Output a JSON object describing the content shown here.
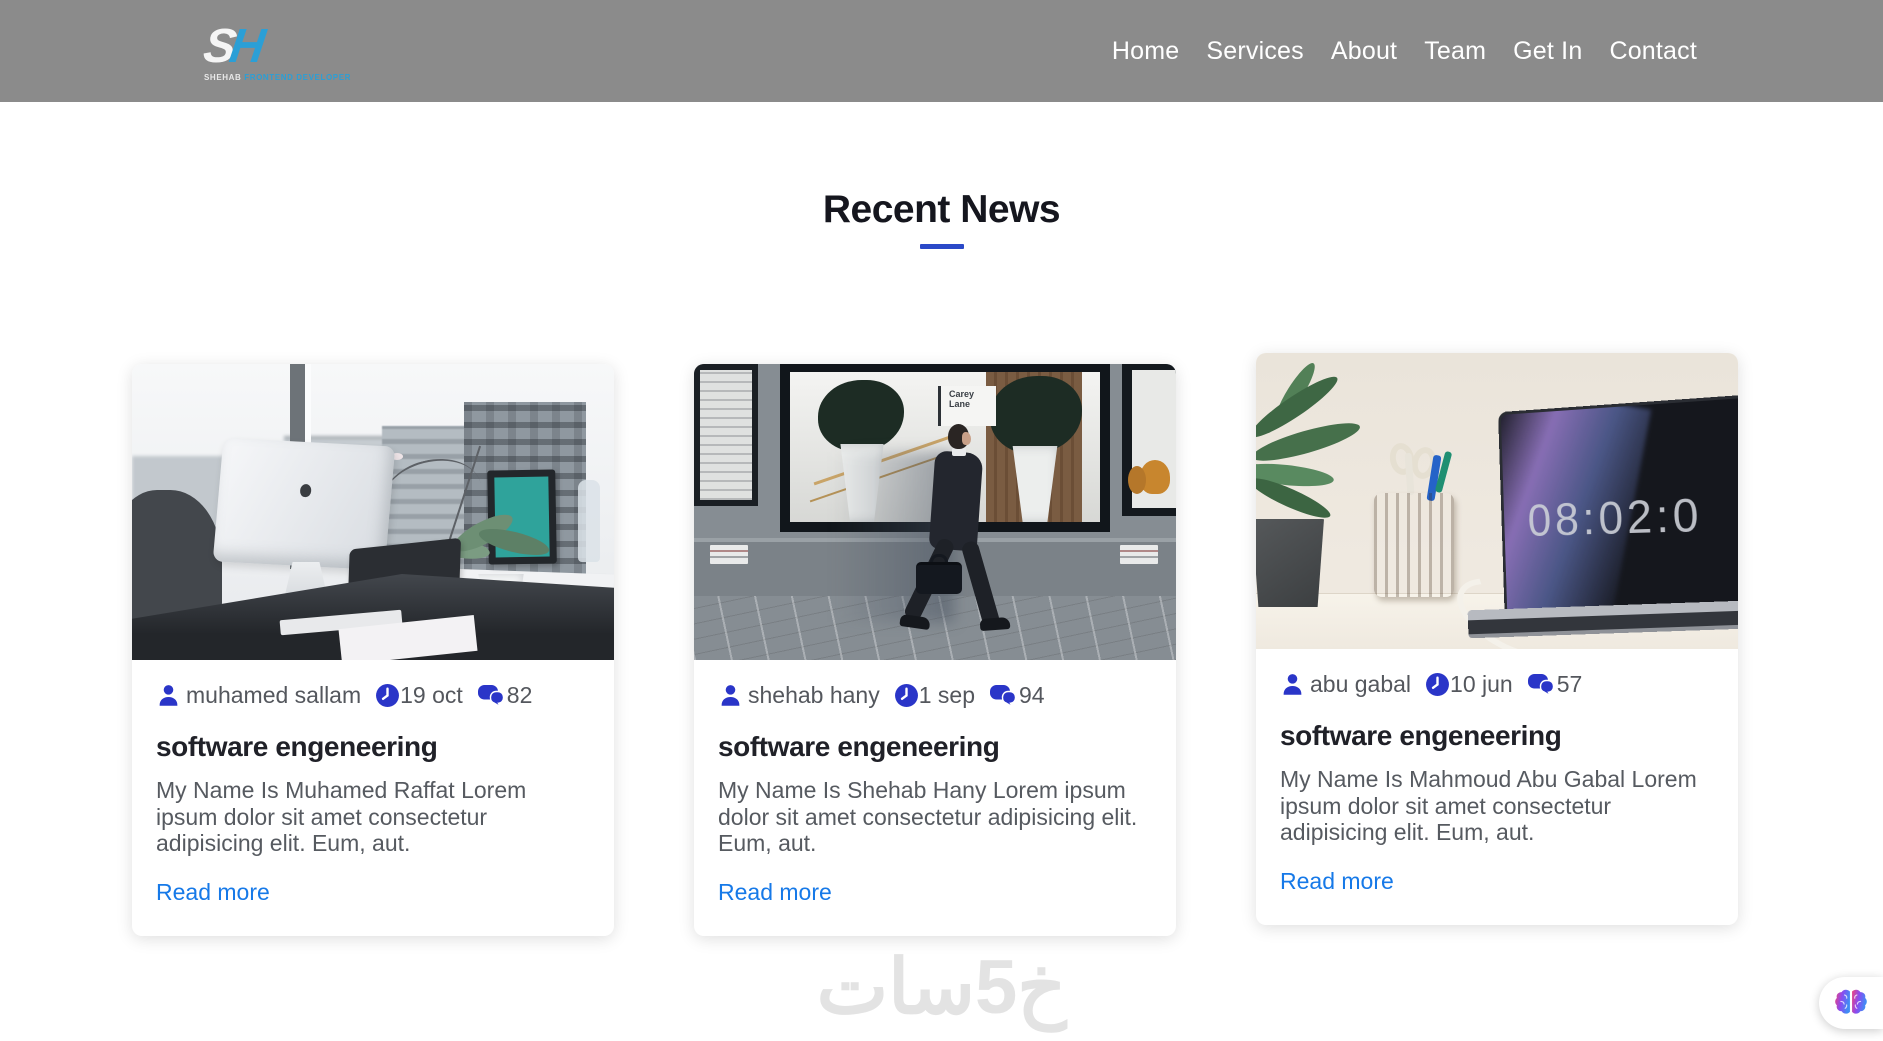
{
  "header": {
    "logo": {
      "letter_s": "S",
      "letter_h": "H",
      "tagline_primary": "SHEHAB",
      "tagline_secondary": "FRONTEND DEVELOPER"
    },
    "nav": [
      "Home",
      "Services",
      "About",
      "Team",
      "Get In",
      "Contact"
    ]
  },
  "section": {
    "title": "Recent News"
  },
  "cards": [
    {
      "author": "muhamed sallam",
      "date": "19 oct",
      "comments": "82",
      "title": "software engeneering",
      "excerpt": "My Name Is Muhamed Raffat Lorem ipsum dolor sit amet consectetur adipisicing elit. Eum, aut.",
      "read_more": "Read more",
      "image_desc": "office desk with iMac, laptop, plant and city skyline through window"
    },
    {
      "author": "shehab hany",
      "date": "1 sep",
      "comments": "94",
      "title": "software engeneering",
      "excerpt": "My Name Is Shehab Hany Lorem ipsum dolor sit amet consectetur adipisicing elit. Eum, aut.",
      "read_more": "Read more",
      "sign_text": "Carey Lane",
      "image_desc": "businessman with briefcase walking past office building window"
    },
    {
      "author": "abu gabal",
      "date": "10 jun",
      "comments": "57",
      "title": "software engeneering",
      "excerpt": "My Name Is Mahmoud Abu Gabal Lorem ipsum dolor sit amet consectetur adipisicing elit. Eum, aut.",
      "read_more": "Read more",
      "clock_text": "08:02:0",
      "image_desc": "white desk with plant, wooden pen holder and laptop showing clock"
    }
  ],
  "watermark": {
    "text": "خ5سات"
  },
  "colors": {
    "header_gray": "#8b8b8b",
    "logo_blue": "#2b9fd6",
    "heading_underline_blue": "#2b49c8",
    "meta_icon_blue": "#2a35c8",
    "link_blue": "#1679e8"
  }
}
